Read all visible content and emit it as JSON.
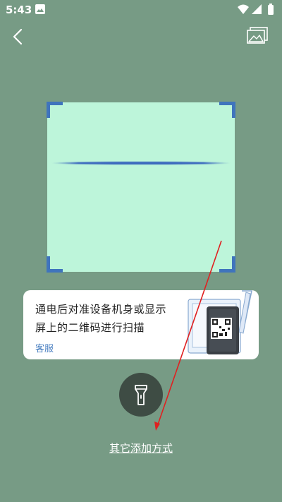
{
  "status_bar": {
    "time": "5:43"
  },
  "icons": {
    "back": "chevron-left-icon",
    "gallery": "image-gallery-icon",
    "flashlight": "flashlight-icon"
  },
  "hint": {
    "text": "通电后对准设备机身或显示屏上的二维码进行扫描",
    "service_link": "客服"
  },
  "bottom": {
    "other_methods": "其它添加方式"
  },
  "colors": {
    "background": "#779b85",
    "scan_area": "#bdf5da",
    "corner_accent": "#3f74bd",
    "link_blue": "#4a7fc1",
    "arrow_red": "#e02020"
  }
}
